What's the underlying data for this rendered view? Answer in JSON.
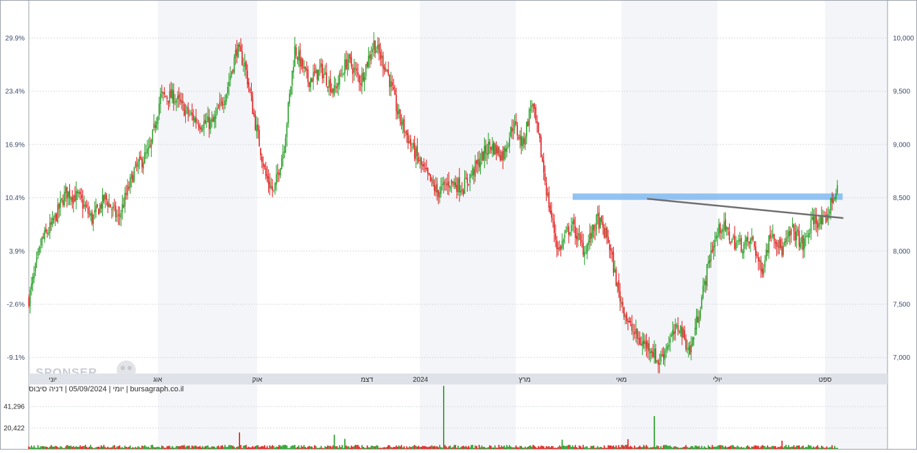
{
  "caption": "יומי | 05/09/2024 | דניה סיבוס | bursagraph.co.il",
  "watermark": "SPONSER",
  "colors": {
    "up": "#1a9a1a",
    "down": "#e01010",
    "band": "#7fb8f0",
    "trendline": "#6e6e6e",
    "grid": "#d6d9e0",
    "shade": "#f4f5f8"
  },
  "chart_data": {
    "type": "candlestick",
    "x_labels": [
      "יוני",
      "אוג",
      "אוק",
      "דצמ",
      "2024",
      "מרץ",
      "מאי",
      "יולי",
      "ספט"
    ],
    "y_left_ticks": [
      "29.9%",
      "23.4%",
      "16.9%",
      "10.4%",
      "3.9%",
      "-2.6%",
      "-9.1%"
    ],
    "y_right_ticks": [
      "10,000",
      "9,500",
      "9,000",
      "8,500",
      "8,000",
      "7,500",
      "7,000"
    ],
    "y_right_values": [
      10000,
      9500,
      9000,
      8500,
      8000,
      7500,
      7000
    ],
    "ylim": [
      6850,
      10350
    ],
    "volume_ticks": [
      "41,296",
      "20,422"
    ],
    "volume_tick_values": [
      41296,
      20422
    ],
    "start_price": 7550,
    "path_keypoints": [
      [
        0,
        7550
      ],
      [
        10,
        8100
      ],
      [
        18,
        8250
      ],
      [
        28,
        8550
      ],
      [
        38,
        8500
      ],
      [
        48,
        8300
      ],
      [
        58,
        8500
      ],
      [
        68,
        8300
      ],
      [
        80,
        8750
      ],
      [
        92,
        8950
      ],
      [
        100,
        9450
      ],
      [
        110,
        9450
      ],
      [
        120,
        9300
      ],
      [
        130,
        9200
      ],
      [
        140,
        9200
      ],
      [
        150,
        9500
      ],
      [
        158,
        9900
      ],
      [
        164,
        9750
      ],
      [
        172,
        9200
      ],
      [
        180,
        8700
      ],
      [
        186,
        8550
      ],
      [
        194,
        9000
      ],
      [
        202,
        9900
      ],
      [
        212,
        9600
      ],
      [
        222,
        9700
      ],
      [
        232,
        9500
      ],
      [
        242,
        9800
      ],
      [
        252,
        9600
      ],
      [
        262,
        9950
      ],
      [
        272,
        9700
      ],
      [
        280,
        9300
      ],
      [
        290,
        9000
      ],
      [
        300,
        8750
      ],
      [
        310,
        8550
      ],
      [
        320,
        8650
      ],
      [
        330,
        8600
      ],
      [
        340,
        8800
      ],
      [
        350,
        9000
      ],
      [
        360,
        8900
      ],
      [
        368,
        9200
      ],
      [
        375,
        9000
      ],
      [
        382,
        9400
      ],
      [
        388,
        9000
      ],
      [
        394,
        8500
      ],
      [
        402,
        8000
      ],
      [
        412,
        8250
      ],
      [
        422,
        8000
      ],
      [
        432,
        8300
      ],
      [
        440,
        8100
      ],
      [
        448,
        7600
      ],
      [
        456,
        7300
      ],
      [
        464,
        7150
      ],
      [
        472,
        7100
      ],
      [
        478,
        6950
      ],
      [
        486,
        7150
      ],
      [
        494,
        7300
      ],
      [
        502,
        7050
      ],
      [
        510,
        7500
      ],
      [
        518,
        8000
      ],
      [
        526,
        8250
      ],
      [
        534,
        8100
      ],
      [
        542,
        8050
      ],
      [
        550,
        8100
      ],
      [
        556,
        7800
      ],
      [
        564,
        8200
      ],
      [
        572,
        8000
      ],
      [
        580,
        8200
      ],
      [
        588,
        8050
      ],
      [
        596,
        8300
      ],
      [
        604,
        8250
      ],
      [
        612,
        8550
      ]
    ],
    "resistance_band": {
      "from_candle": 413,
      "to_candle": 618,
      "low": 8480,
      "high": 8540
    },
    "trendline": {
      "from": [
        470,
        8490
      ],
      "to": [
        618,
        8310
      ]
    },
    "volume_spikes": [
      [
        315,
        61500
      ],
      [
        475,
        32000
      ],
      [
        160,
        16000
      ],
      [
        232,
        13800
      ],
      [
        240,
        9800
      ],
      [
        455,
        9500
      ],
      [
        405,
        9000
      ],
      [
        572,
        8000
      ]
    ]
  }
}
